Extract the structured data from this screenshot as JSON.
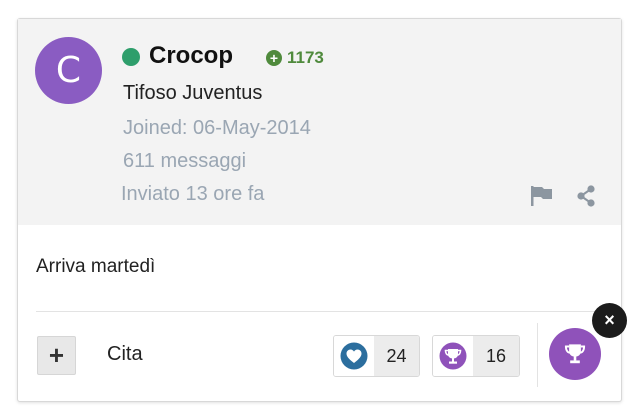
{
  "post": {
    "avatar_letter": "C",
    "username": "Crocop",
    "reputation": "1173",
    "rank": "Tifoso Juventus",
    "joined": "Joined: 06-May-2014",
    "posts": "611 messaggi",
    "sent": "Inviato 13 ore fa",
    "content": "Arriva martedì"
  },
  "actions": {
    "plus_label": "+",
    "quote_label": "Cita",
    "close_label": "×"
  },
  "reactions": [
    {
      "name": "like",
      "count": "24"
    },
    {
      "name": "trophy",
      "count": "16"
    }
  ],
  "colors": {
    "avatar": "#8a5cc2",
    "online": "#2e9e6b",
    "reputation": "#4f8a3c",
    "trophy": "#8f52ba",
    "like": "#2c6e9e"
  }
}
